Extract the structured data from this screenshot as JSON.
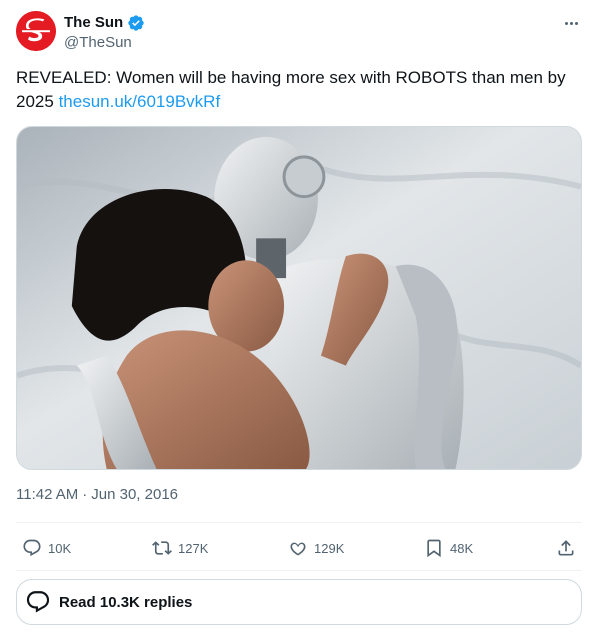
{
  "author": {
    "display_name": "The Sun",
    "handle": "@TheSun",
    "avatar_icon": "the-sun-logo",
    "verified_icon": "verified-badge-icon",
    "verified_color": "#1d9bf0"
  },
  "tweet": {
    "text": "REVEALED: Women will be having more sex with ROBOTS than men by 2025",
    "link": "thesun.uk/6019BvkRf",
    "time": "11:42 AM",
    "separator": "·",
    "date": "Jun 30, 2016"
  },
  "actions": {
    "replies": {
      "icon": "reply-icon",
      "count": "10K"
    },
    "retweets": {
      "icon": "retweet-icon",
      "count": "127K"
    },
    "likes": {
      "icon": "heart-icon",
      "count": "129K"
    },
    "bookmarks": {
      "icon": "bookmark-icon",
      "count": "48K"
    },
    "share": {
      "icon": "share-icon"
    }
  },
  "read_replies": {
    "label": "Read 10.3K replies",
    "icon": "reply-bubble-icon"
  },
  "colors": {
    "text": "#0f1419",
    "secondary": "#536471",
    "link": "#1d9bf0",
    "brand": "#e51b24",
    "border": "#cfd9de"
  }
}
